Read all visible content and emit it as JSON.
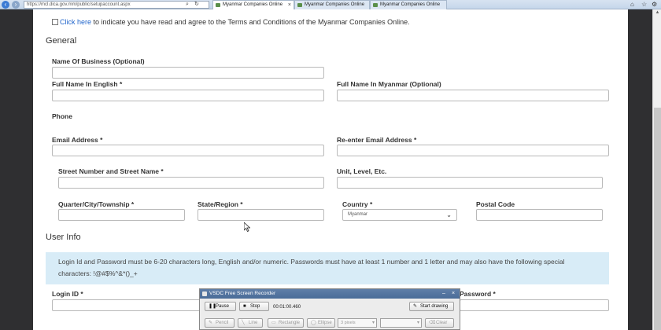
{
  "browser": {
    "address": "https://mcl.dica.gov.mm/public/setupaccount.aspx",
    "tabs": [
      {
        "label": "Myanmar Companies Online"
      },
      {
        "label": "Myanmar Companies Online"
      },
      {
        "label": "Myanmar Companies Online"
      }
    ]
  },
  "form": {
    "terms_link": "Click here",
    "terms_text": " to indicate you have read and agree to the Terms and Conditions of the Myanmar Companies Online.",
    "general_heading": "General",
    "name_of_business_label": "Name Of Business (Optional)",
    "full_name_en_label": "Full Name In English *",
    "full_name_mm_label": "Full Name In Myanmar (Optional)",
    "phone_label": "Phone",
    "email_label": "Email Address *",
    "reenter_email_label": "Re-enter Email Address *",
    "street_label": "Street Number and Street Name *",
    "unit_label": "Unit, Level, Etc.",
    "quarter_label": "Quarter/City/Township *",
    "state_label": "State/Region *",
    "country_label": "Country *",
    "country_value": "Myanmar",
    "postal_label": "Postal Code",
    "user_info_heading": "User Info",
    "info_line1": "Login Id and Password must be 6-20 characters long, English and/or numeric. Passwords must have at least 1 number and 1 letter and may also have the following special",
    "info_line2": "characters: !@#$%^&*()_+",
    "login_id_label": "Login ID *",
    "password_label": "Password *"
  },
  "recorder": {
    "title": "VSDC Free Screen Recorder",
    "pause": "Pause",
    "stop": "Stop",
    "time": "00:01:00.460",
    "start_drawing": "Start drawing",
    "pencil": "Pencil",
    "line": "Line",
    "rectangle": "Rectangle",
    "ellipse": "Ellipse",
    "pixels": "3 pixels",
    "clear": "Clear"
  }
}
